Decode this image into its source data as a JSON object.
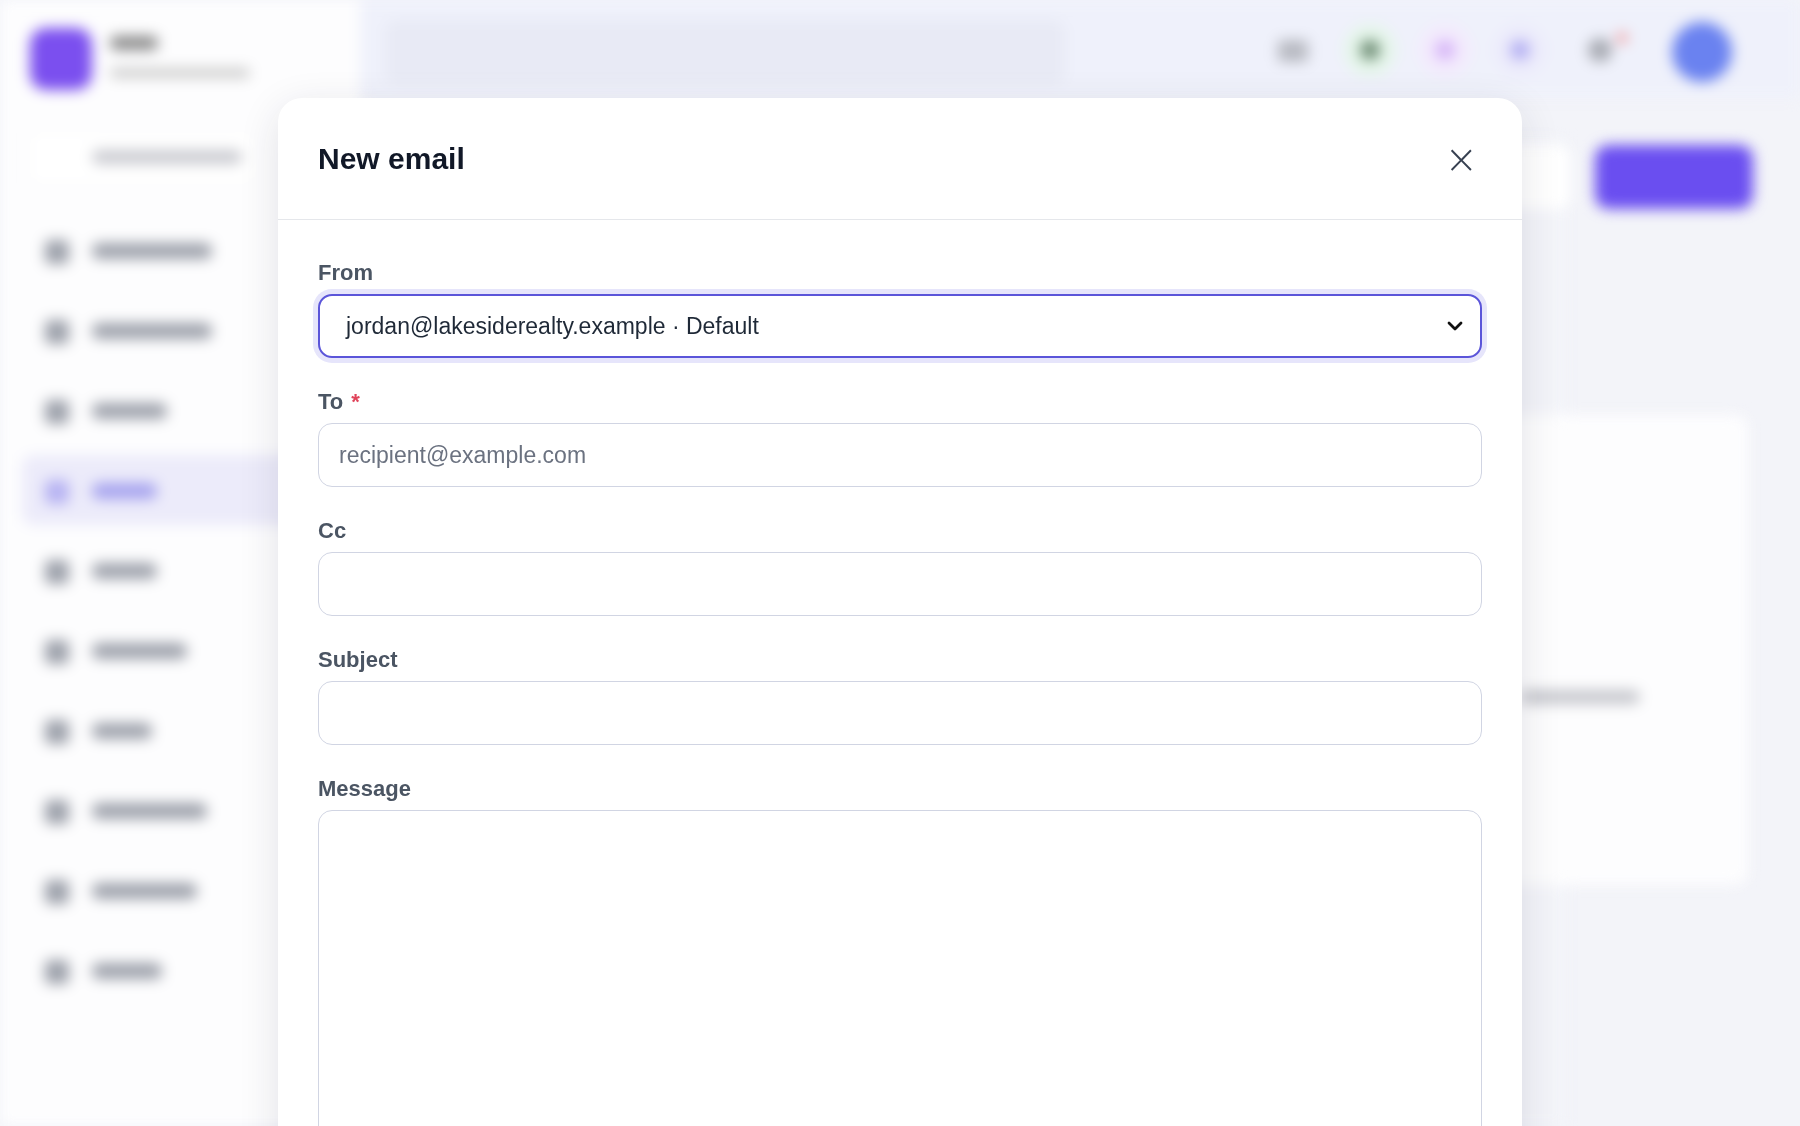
{
  "dialog": {
    "title": "New email",
    "close": "×",
    "fields": [
      {
        "kind": "select",
        "label": "From",
        "focused": true,
        "value": "jordan@lakesiderealty.example · Default"
      },
      {
        "kind": "input",
        "label": "To",
        "required_mark": "*",
        "focused": false,
        "placeholder": "recipient@example.com"
      },
      {
        "kind": "input",
        "label": "Cc",
        "focused": false
      },
      {
        "kind": "input",
        "label": "Subject",
        "focused": false
      },
      {
        "kind": "textarea",
        "label": "Message",
        "focused": false
      }
    ]
  }
}
